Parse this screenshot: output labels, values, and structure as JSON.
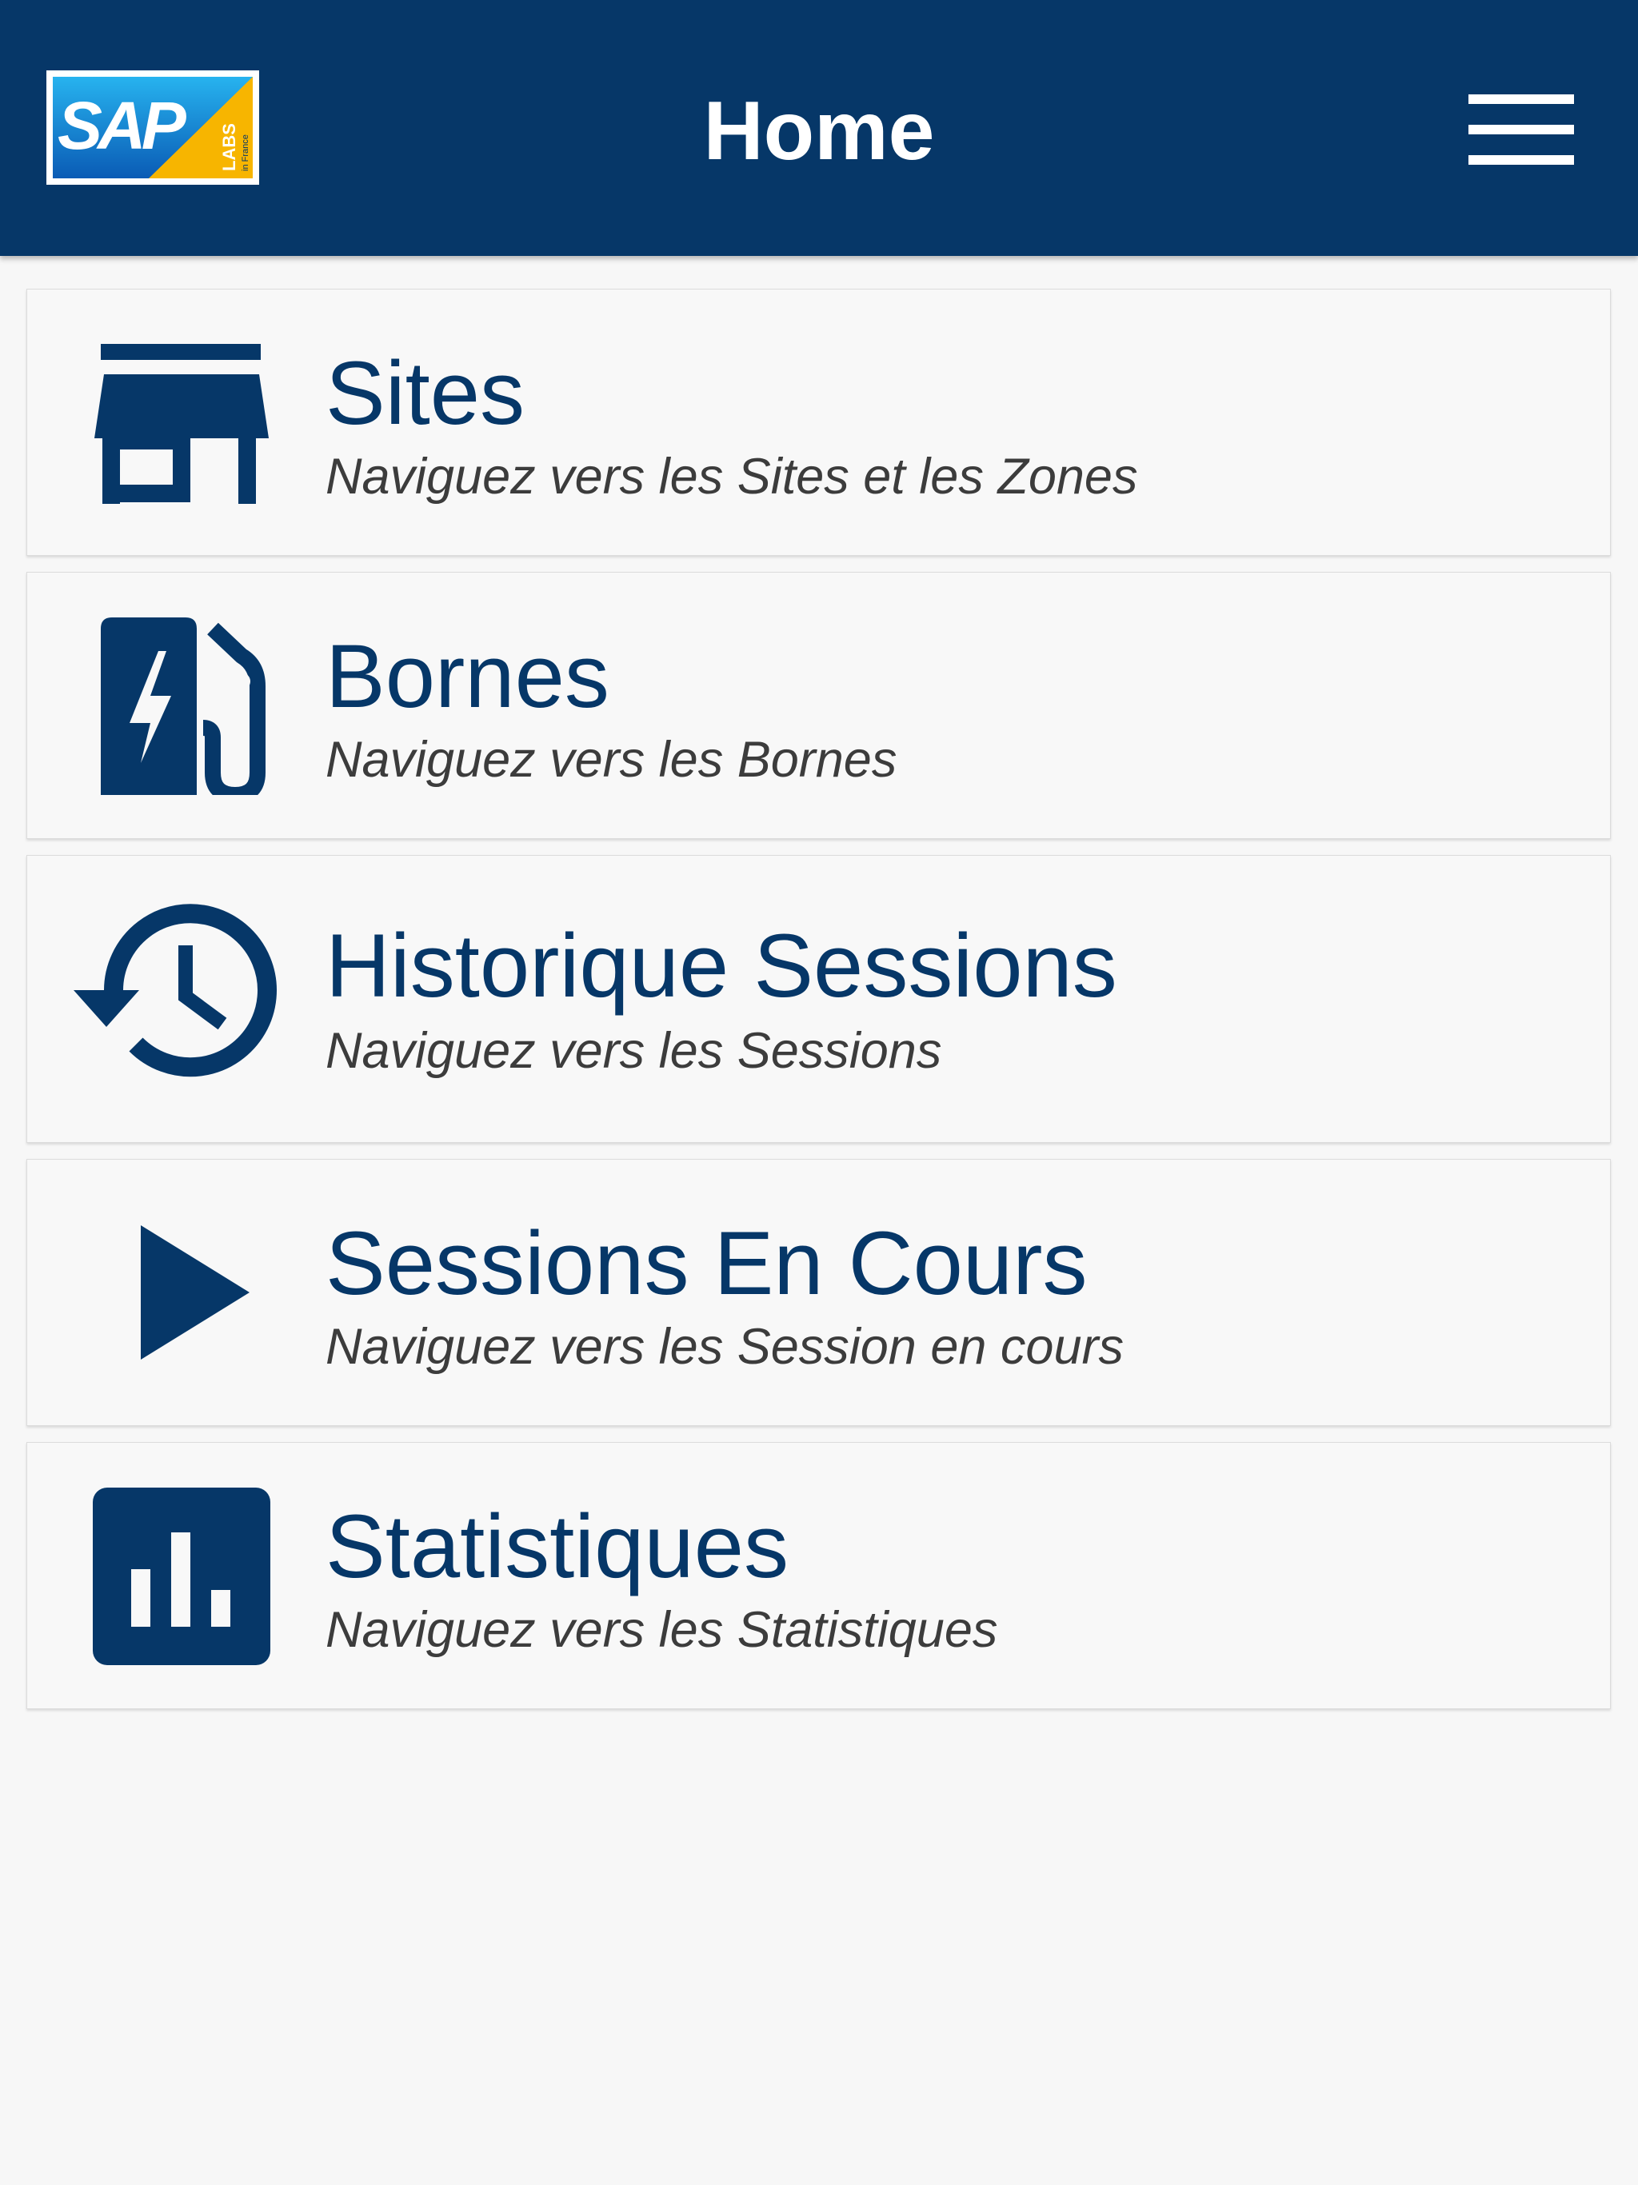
{
  "header": {
    "logo": {
      "brand_text": "SAP",
      "badge_text": "LABS",
      "badge_subtext": "in France"
    },
    "title": "Home",
    "menu_icon": "hamburger-menu-icon"
  },
  "items": [
    {
      "title": "Sites",
      "subtitle": "Naviguez vers les Sites et les Zones",
      "icon": "store-icon"
    },
    {
      "title": "Bornes",
      "subtitle": "Naviguez vers les Bornes",
      "icon": "ev-charger-icon"
    },
    {
      "title": "Historique Sessions",
      "subtitle": "Naviguez vers les Sessions",
      "icon": "history-icon"
    },
    {
      "title": "Sessions En Cours",
      "subtitle": "Naviguez vers les Session en cours",
      "icon": "play-icon"
    },
    {
      "title": "Statistiques",
      "subtitle": "Naviguez vers les Statistiques",
      "icon": "bar-chart-icon"
    }
  ],
  "colors": {
    "header_bg": "#063768",
    "accent": "#063768",
    "page_bg": "#f7f7f7",
    "card_bg": "#f8f8f8",
    "subtitle_text": "#3c3c3c",
    "logo_blue": "#1a6fc4",
    "logo_yellow": "#f7b500"
  }
}
